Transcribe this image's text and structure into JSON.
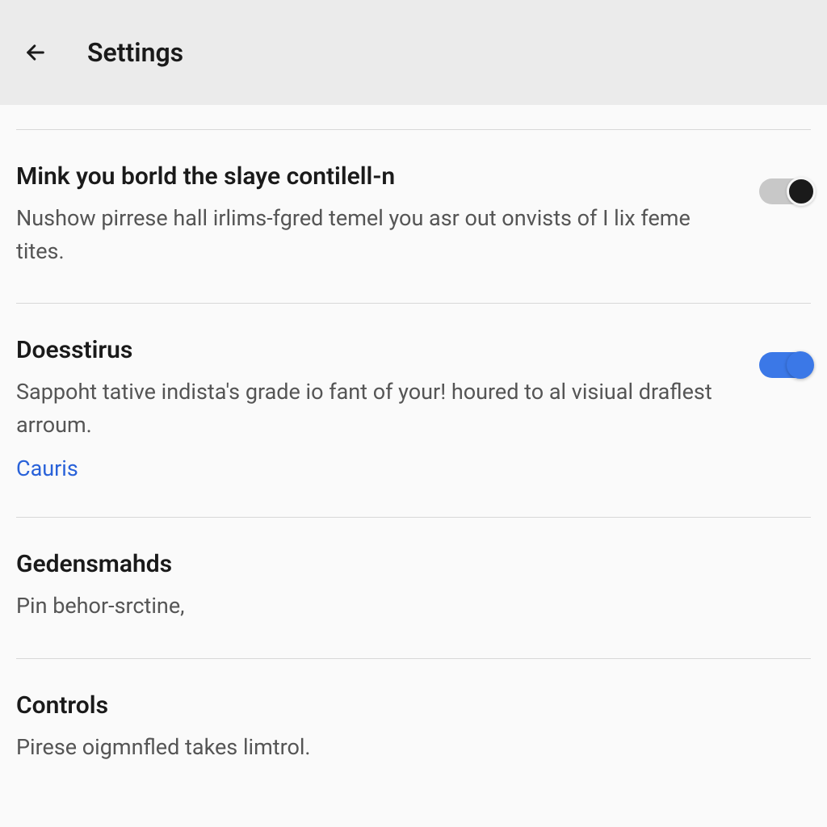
{
  "header": {
    "title": "Settings"
  },
  "settings": [
    {
      "title": "Mink you borld the slaye contilell-n",
      "description": "Nushow pirrese hall irlims-fgred temel you asr out onvists of I lix feme tites.",
      "link": null,
      "toggle": "off"
    },
    {
      "title": "Doesstirus",
      "description": "Sappoht tative indista's grade io fant of your! houred to al visiual draflest arroum.",
      "link": "Cauris",
      "toggle": "on"
    },
    {
      "title": "Gedensmahds",
      "description": "Pin behor-srctine,",
      "link": null,
      "toggle": null
    },
    {
      "title": "Controls",
      "description": "Pirese oigmnfled takes limtrol.",
      "link": null,
      "toggle": null
    }
  ]
}
